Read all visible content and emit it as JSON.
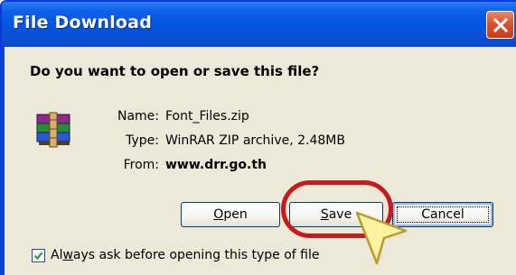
{
  "window": {
    "title": "File Download",
    "close_icon": "close-x-icon"
  },
  "dialog": {
    "question": "Do you want to open or save this file?",
    "file_icon": "winrar-archive-icon",
    "name_label": "Name:",
    "name_value": "Font_Files.zip",
    "type_label": "Type:",
    "type_value": "WinRAR ZIP archive, 2.48MB",
    "from_label": "From:",
    "from_value": "www.drr.go.th"
  },
  "buttons": {
    "open_mnemonic": "O",
    "open_rest": "pen",
    "save_mnemonic": "S",
    "save_rest": "ave",
    "cancel": "Cancel"
  },
  "checkbox": {
    "checked": true,
    "label_prefix": "Al",
    "label_mnemonic": "w",
    "label_rest": "ays ask before opening this type of file"
  },
  "annotation": {
    "ring_color": "#c81a1a",
    "cursor_color": "#fff3a0"
  }
}
